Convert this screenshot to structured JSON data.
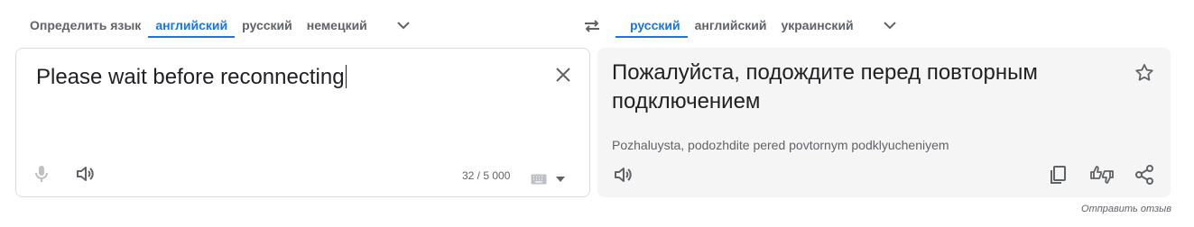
{
  "source_langs": {
    "tabs": [
      {
        "label": "Определить язык",
        "active": false
      },
      {
        "label": "английский",
        "active": true
      },
      {
        "label": "русский",
        "active": false
      },
      {
        "label": "немецкий",
        "active": false
      }
    ],
    "more_icon": "chevron-down-icon"
  },
  "swap_icon": "swap-arrows-icon",
  "target_langs": {
    "tabs": [
      {
        "label": "русский",
        "active": true
      },
      {
        "label": "английский",
        "active": false
      },
      {
        "label": "украинский",
        "active": false
      }
    ],
    "more_icon": "chevron-down-icon"
  },
  "source": {
    "text": "Please wait before reconnecting",
    "char_count": "32 / 5 000"
  },
  "target": {
    "text": "Пожалуйста, подождите перед повторным подключением",
    "transliteration": "Pozhaluysta, podozhdite pered povtornym podklyucheniyem"
  },
  "feedback_label": "Отправить отзыв",
  "colors": {
    "accent": "#1a73e8",
    "icon": "#5f6368",
    "target_bg": "#f5f5f5"
  }
}
